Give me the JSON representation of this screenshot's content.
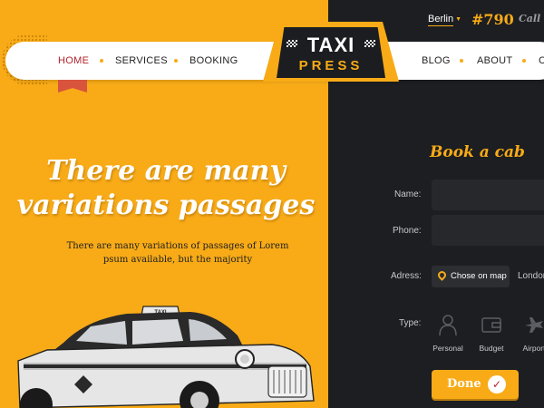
{
  "topbar": {
    "city": "Berlin",
    "phone": "#790",
    "call_text": "Call us"
  },
  "nav": {
    "left_items": [
      {
        "label": "HOME",
        "active": true
      },
      {
        "label": "SERVICES",
        "active": false
      },
      {
        "label": "BOOKING",
        "active": false
      }
    ],
    "right_items": [
      {
        "label": "BLOG",
        "active": false
      },
      {
        "label": "ABOUT",
        "active": false
      },
      {
        "label": "C",
        "active": false
      }
    ]
  },
  "logo": {
    "line1": "TAXI",
    "line2": "PRESS"
  },
  "hero": {
    "title": "There are many variations passages",
    "subtitle": "There are many variations of passages of Lorem psum available, but the majority"
  },
  "booking": {
    "title": "Book a cab",
    "name_label": "Name:",
    "phone_label": "Phone:",
    "address_label": "Adress:",
    "map_button": "Chose on map",
    "address_value": "London",
    "type_label": "Type:",
    "types": [
      {
        "label": "Personal",
        "icon": "person-icon"
      },
      {
        "label": "Budget",
        "icon": "wallet-icon"
      },
      {
        "label": "Airport",
        "icon": "airplane-icon"
      }
    ],
    "done_label": "Done"
  },
  "colors": {
    "accent": "#f8ab17",
    "dark": "#1c1e21",
    "active_nav": "#b4232d"
  }
}
